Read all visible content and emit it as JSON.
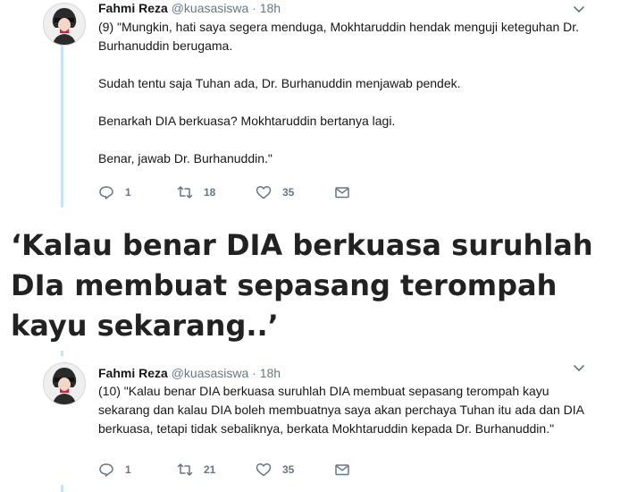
{
  "tweets": [
    {
      "name": "Fahmi Reza",
      "handle": "@kuasasiswa",
      "dot": "·",
      "time": "18h",
      "paragraphs": [
        "(9) \"Mungkin, hati saya segera menduga, Mokhtaruddin hendak menguji keteguhan Dr. Burhanuddin berugama.",
        "Sudah tentu saja Tuhan ada, Dr. Burhanuddin menjawab pendek.",
        "Benarkah DIA berkuasa? Mokhtaruddin bertanya lagi.",
        "Benar, jawab Dr. Burhanuddin.\""
      ],
      "replies": "1",
      "retweets": "18",
      "likes": "35"
    },
    {
      "name": "Fahmi Reza",
      "handle": "@kuasasiswa",
      "dot": "·",
      "time": "18h",
      "paragraphs": [
        "(10) \"Kalau benar DIA berkuasa suruhlah DIA membuat sepasang terompah kayu sekarang dan kalau DIA boleh membuatnya saya akan perchaya Tuhan itu ada dan DIA berkuasa, tetapi tidak sebaliknya, berkata Mokhtaruddin kepada Dr. Burhanuddin.\""
      ],
      "replies": "1",
      "retweets": "21",
      "likes": "35"
    }
  ],
  "pull_quote": "‘Kalau benar DIA berkuasa suruhlah DIa membuat sepasang terompah kayu sekarang..’",
  "icons": {
    "reply": "reply-icon",
    "retweet": "retweet-icon",
    "like": "heart-icon",
    "message": "envelope-icon",
    "menu": "chevron-down-icon"
  },
  "colors": {
    "thread_line": "#c5e4f5",
    "meta_gray": "#657786"
  }
}
